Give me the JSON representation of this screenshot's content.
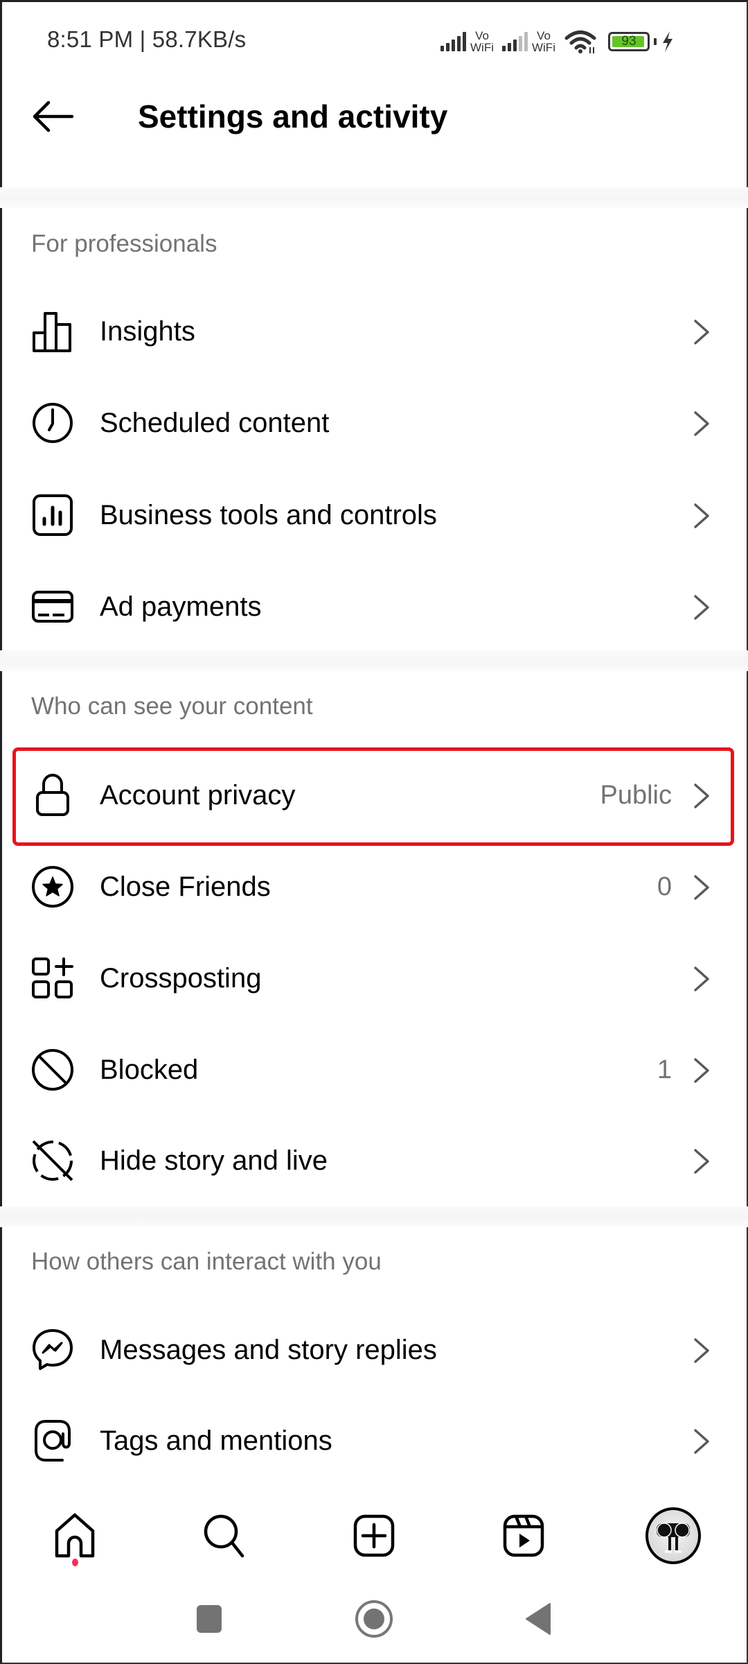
{
  "status_bar": {
    "time_speed": "8:51 PM | 58.7KB/s",
    "sim1_label_top": "Vo",
    "sim1_label_bottom": "WiFi",
    "sim2_label_top": "Vo",
    "sim2_label_bottom": "WiFi",
    "battery_level": "93",
    "battery_color": "#66c22a",
    "charging": true
  },
  "header": {
    "back_icon": "arrow-left-icon",
    "title": "Settings and activity"
  },
  "sections": [
    {
      "label": "For professionals",
      "items": [
        {
          "icon": "insights-bar-chart-icon",
          "label": "Insights",
          "value": ""
        },
        {
          "icon": "clock-icon",
          "label": "Scheduled content",
          "value": ""
        },
        {
          "icon": "business-tools-chart-icon",
          "label": "Business tools and controls",
          "value": ""
        },
        {
          "icon": "credit-card-icon",
          "label": "Ad payments",
          "value": ""
        }
      ]
    },
    {
      "label": "Who can see your content",
      "items": [
        {
          "icon": "lock-icon",
          "label": "Account privacy",
          "value": "Public",
          "highlighted": true
        },
        {
          "icon": "star-circle-icon",
          "label": "Close Friends",
          "value": "0"
        },
        {
          "icon": "crossposting-grid-plus-icon",
          "label": "Crossposting",
          "value": ""
        },
        {
          "icon": "blocked-icon",
          "label": "Blocked",
          "value": "1"
        },
        {
          "icon": "hide-story-icon",
          "label": "Hide story and live",
          "value": ""
        }
      ]
    },
    {
      "label": "How others can interact with you",
      "items": [
        {
          "icon": "messenger-icon",
          "label": "Messages and story replies",
          "value": ""
        },
        {
          "icon": "at-sign-icon",
          "label": "Tags and mentions",
          "value": ""
        }
      ]
    }
  ],
  "highlight_color": "#e8141c",
  "bottom_nav": {
    "items": [
      "home-icon",
      "search-icon",
      "create-post-icon",
      "reels-icon",
      "profile-avatar"
    ],
    "home_has_notification": true,
    "notification_color": "#ff2b55"
  },
  "system_nav": [
    "recents-square-icon",
    "home-circle-icon",
    "back-triangle-icon"
  ]
}
